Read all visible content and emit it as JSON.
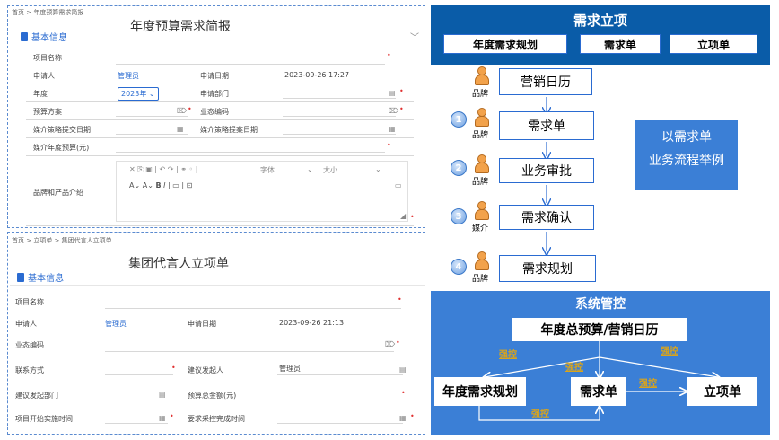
{
  "form1": {
    "breadcrumb": "首页 > 年度预算需求简报",
    "title": "年度预算需求简报",
    "section": "基本信息",
    "fields": {
      "project_name": "项目名称",
      "applicant": "申请人",
      "applicant_value": "管理员",
      "apply_date": "申请日期",
      "apply_date_value": "2023-09-26 17:27",
      "year": "年度",
      "year_value": "2023年",
      "apply_dept": "申请部门",
      "budget_plan": "预算方案",
      "biz_code": "业态编码",
      "media_submit_date": "媒介策略提交日期",
      "media_proposal_date": "媒介策略提案日期",
      "media_budget": "媒介年度预算(元)",
      "brand_intro": "品牌和产品介绍"
    },
    "toolbar": {
      "font": "字体",
      "size": "大小"
    }
  },
  "form2": {
    "breadcrumb": "首页 > 立项单 > 集团代言人立项单",
    "title": "集团代言人立项单",
    "section": "基本信息",
    "fields": {
      "project_name": "项目名称",
      "applicant": "申请人",
      "applicant_value": "管理员",
      "apply_date": "申请日期",
      "apply_date_value": "2023-09-26 21:13",
      "biz_code": "业态编码",
      "contact": "联系方式",
      "proposer": "建议发起人",
      "proposer_value": "管理员",
      "proposer_dept": "建议发起部门",
      "budget_total": "预算总金额(元)",
      "start_time": "项目开始实施时间",
      "purchase_done": "要求采控完成时间"
    }
  },
  "diagram": {
    "header_title": "需求立项",
    "tabs": [
      "年度需求规划",
      "需求单",
      "立项单"
    ],
    "steps": [
      {
        "label": "营销日历",
        "role": "品牌",
        "num": ""
      },
      {
        "label": "需求单",
        "role": "品牌",
        "num": "1"
      },
      {
        "label": "业务审批",
        "role": "品牌",
        "num": "2"
      },
      {
        "label": "需求确认",
        "role": "媒介",
        "num": "3"
      },
      {
        "label": "需求规划",
        "role": "品牌",
        "num": "4"
      }
    ],
    "note_line1": "以需求单",
    "note_line2": "业务流程举例",
    "control_title": "系统管控",
    "control_top": "年度总预算/营销日历",
    "control_left": "年度需求规划",
    "control_mid": "需求单",
    "control_right": "立项单",
    "strong": "强控"
  },
  "colors": {
    "header_blue": "#0a5ca8",
    "control_blue": "#3b7fd6",
    "accent": "#2a6bd1",
    "strong_gold": "#d9a41c"
  }
}
